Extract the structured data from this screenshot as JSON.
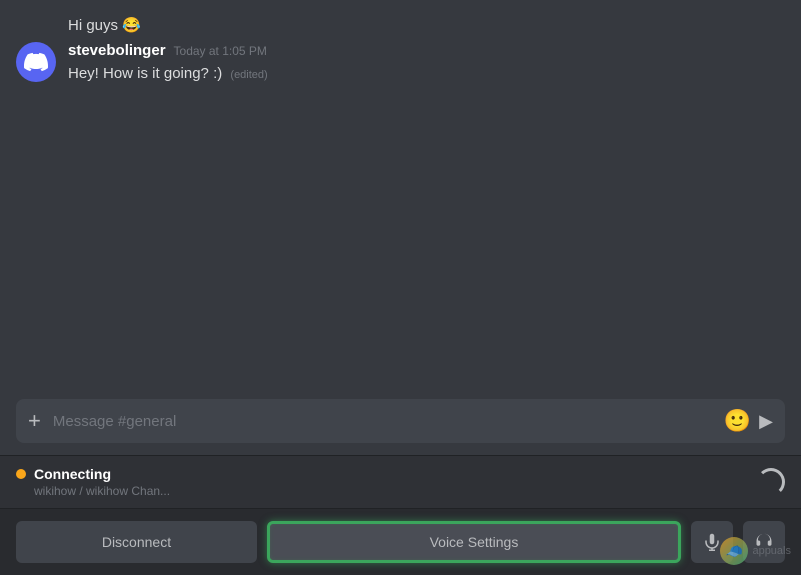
{
  "chat": {
    "messages": [
      {
        "id": "msg1",
        "author": "",
        "timestamp": "",
        "text": "Hi guys 😂",
        "edited": false,
        "avatar_type": "yellow_emoji",
        "avatar_emoji": "😄"
      },
      {
        "id": "msg2",
        "author": "stevebolinger",
        "timestamp": "Today at 1:05 PM",
        "text": "Hey! How is it going? :)",
        "edited": true,
        "edited_label": "(edited)",
        "avatar_type": "discord",
        "avatar_emoji": "🎮"
      }
    ]
  },
  "input": {
    "placeholder": "Message #general"
  },
  "voice_status": {
    "connecting_label": "Connecting",
    "channel_path": "wikihow / wikihow Chan...",
    "dot_color": "#faa61a"
  },
  "voice_controls": {
    "disconnect_label": "Disconnect",
    "voice_settings_label": "Voice Settings",
    "mic_label": "Toggle Microphone",
    "headset_label": "Toggle Headset"
  },
  "icons": {
    "plus": "+",
    "emoji": "🙂",
    "send": "▶",
    "mic": "🎤",
    "headset": "🎧"
  },
  "watermark": {
    "label": "appuals"
  }
}
